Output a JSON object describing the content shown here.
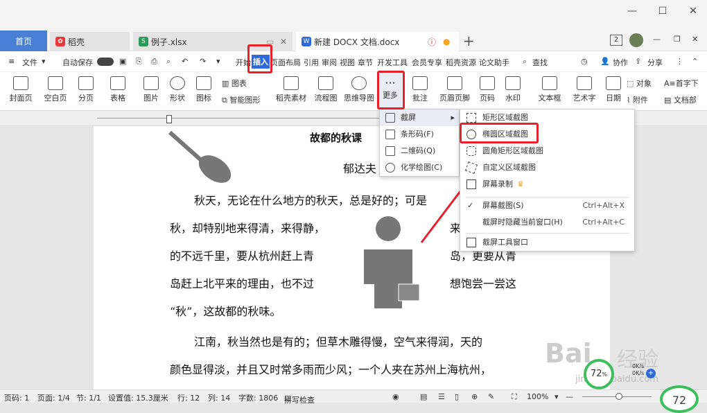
{
  "tabs": {
    "home": "首页",
    "wps": "稻壳",
    "xlsx": "例子.xlsx",
    "docx": "新建 DOCX 文档.docx",
    "badge": "2"
  },
  "menubar": {
    "file": "文件",
    "autosave": "自动保存",
    "start": "开始",
    "insert": "插入",
    "layout": "页面布局",
    "ref": "引用",
    "review": "审阅",
    "view": "视图",
    "chapter": "章节",
    "dev": "开发工具",
    "vip": "会员专享",
    "docer": "稻壳资源",
    "thesis": "论文助手",
    "search": "查找",
    "collab": "协作",
    "share": "分享"
  },
  "ribbon": {
    "cover": "封面页",
    "blank": "空白页",
    "pagebreak": "分页",
    "table": "表格",
    "picture": "图片",
    "shape": "形状",
    "icon": "图标",
    "chart": "图表",
    "smartart": "智能图形",
    "docer_material": "稻壳素材",
    "flowchart": "流程图",
    "mindmap": "思维导图",
    "more": "更多",
    "comment": "批注",
    "header_footer": "页眉页脚",
    "page_num": "页码",
    "watermark": "水印",
    "textbox": "文本框",
    "wordart": "艺术字",
    "date": "日期",
    "object": "对象",
    "dropcap": "首字下",
    "attach": "附件",
    "docpart": "文档部"
  },
  "more_menu": {
    "screenshot": "截屏",
    "barcode": "条形码(F)",
    "qrcode": "二维码(Q)",
    "chem": "化学绘图(C)"
  },
  "screenshot_menu": {
    "rect": "矩形区域截图",
    "ellipse": "椭圆区域截图",
    "round": "圆角矩形区域截图",
    "custom": "自定义区域截图",
    "record": "屏幕录制",
    "screen": "屏幕截图(S)",
    "screen_sc": "Ctrl+Alt+X",
    "hide": "截屏时隐藏当前窗口(H)",
    "hide_sc": "Ctrl+Alt+C",
    "toolwin": "截屏工具窗口"
  },
  "doc": {
    "title": "故都的秋课",
    "author": "郁达夫",
    "l1": "秋天，无论在什么地方的秋天，总是好的；可是",
    "l2a": "秋，却特别地来得清，来得静，",
    "l2b": "来",
    "l3a": "的不远千里，要从杭州赶上青",
    "l3b": "岛，更要从青",
    "l4a": "岛赶上北平来的理由，也不过",
    "l4b": "想饱尝一尝这",
    "l5": "“秋”，这故都的秋味。",
    "l6": "江南，秋当然也是有的；但草木雕得慢，空气来得润，天的",
    "l7": "颜色显得淡，并且又时常多雨而少风；一个人夹在苏州上海杭州，"
  },
  "status": {
    "page": "页码: 1",
    "pages": "页面: 1/4",
    "section": "节: 1/1",
    "setting": "设置值: 15.3厘米",
    "row": "行: 12",
    "col": "列: 14",
    "words": "字数: 1806",
    "spell": "拼写检查",
    "zoom": "100%",
    "percent": "72",
    "percent_unit": "%",
    "net1": "0K/s",
    "net2": "0K/s",
    "corner": "72"
  },
  "watermark": {
    "brand": "Bai",
    "brand2": "经验",
    "url": "jingyan.baidu.com"
  }
}
